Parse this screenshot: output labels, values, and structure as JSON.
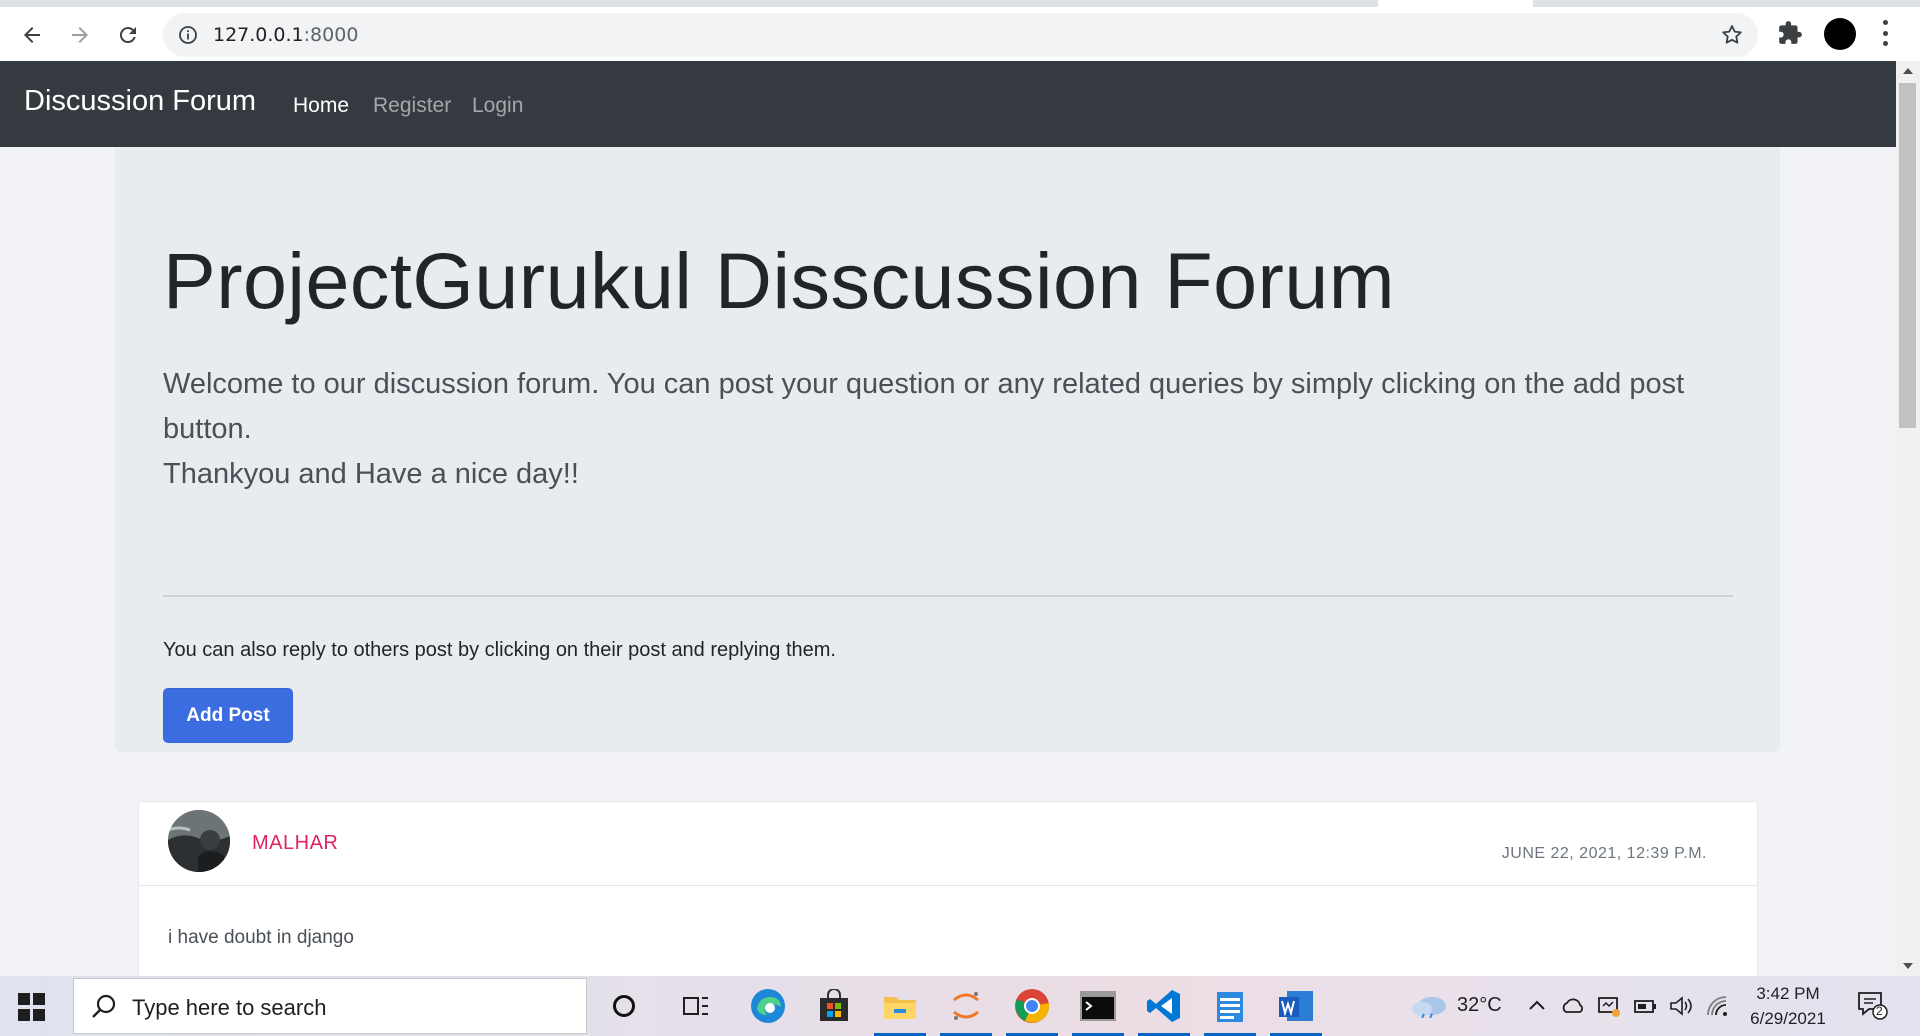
{
  "browser": {
    "url_host": "127.0.0.1",
    "url_port": ":8000",
    "icons": [
      "back-arrow-icon",
      "forward-arrow-icon",
      "reload-icon",
      "info-icon",
      "star-icon",
      "puzzle-icon",
      "profile-avatar",
      "kebab-menu-icon"
    ]
  },
  "navbar": {
    "brand": "Discussion Forum",
    "links": [
      {
        "label": "Home",
        "active": true
      },
      {
        "label": "Register",
        "active": false
      },
      {
        "label": "Login",
        "active": false
      }
    ]
  },
  "jumbotron": {
    "title": "ProjectGurukul Disscussion Forum",
    "lead_line1": "Welcome to our discussion forum. You can post your question or any related queries by simply clicking on the add post button.",
    "lead_line2": "Thankyou and Have a nice day!!",
    "note": "You can also reply to others post by clicking on their post and replying them.",
    "button_label": "Add Post"
  },
  "posts": [
    {
      "username": "MALHAR",
      "date": "JUNE 22, 2021, 12:39 P.M.",
      "body": "i have doubt in django"
    }
  ],
  "taskbar": {
    "search_placeholder": "Type here to search",
    "temperature": "32°C",
    "time": "3:42 PM",
    "date": "6/29/2021",
    "notification_count": "2"
  },
  "colors": {
    "navbar_bg": "#343a40",
    "jumbotron_bg": "#e9ecef",
    "primary_button": "#3b6ce0",
    "username": "#e0245e"
  }
}
